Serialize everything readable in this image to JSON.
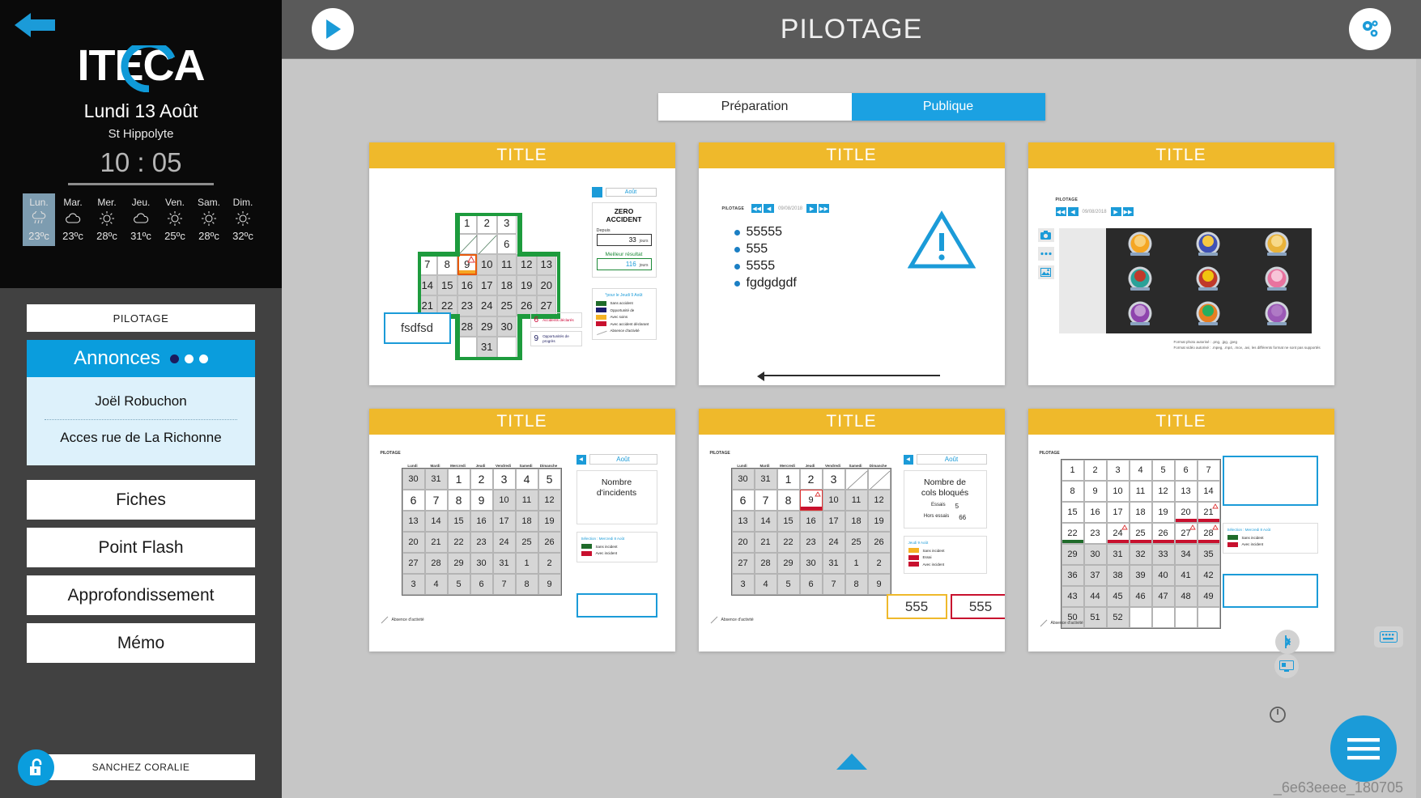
{
  "sidebar": {
    "back_icon": "back-arrow-icon",
    "logo": "ITECA",
    "date": "Lundi 13 Août",
    "place": "St Hippolyte",
    "clock": "10 : 05",
    "weather": [
      {
        "day": "Lun.",
        "temp": "23ºc",
        "icon": "rain-icon",
        "active": true
      },
      {
        "day": "Mar.",
        "temp": "23ºc",
        "icon": "cloud-icon",
        "active": false
      },
      {
        "day": "Mer.",
        "temp": "28ºc",
        "icon": "sun-icon",
        "active": false
      },
      {
        "day": "Jeu.",
        "temp": "31ºc",
        "icon": "cloud-icon",
        "active": false
      },
      {
        "day": "Ven.",
        "temp": "25ºc",
        "icon": "sun-icon",
        "active": false
      },
      {
        "day": "Sam.",
        "temp": "28ºc",
        "icon": "sun-icon",
        "active": false
      },
      {
        "day": "Dim.",
        "temp": "32ºc",
        "icon": "sun-icon",
        "active": false
      }
    ],
    "pilotage_label": "PILOTAGE",
    "annonces_label": "Annonces",
    "annonces_items": [
      "Joël Robuchon",
      "Acces rue de La Richonne"
    ],
    "menu": [
      "Fiches",
      "Point Flash",
      "Approfondissement",
      "Mémo"
    ],
    "user": "SANCHEZ CORALIE",
    "lock_icon": "unlock-icon"
  },
  "header": {
    "title": "PILOTAGE",
    "play_icon": "play-icon",
    "settings_icon": "gears-icon"
  },
  "tabs": [
    {
      "label": "Préparation",
      "active": false
    },
    {
      "label": "Publique",
      "active": true
    }
  ],
  "cards": [
    {
      "title": "TITLE"
    },
    {
      "title": "TITLE"
    },
    {
      "title": "TITLE"
    },
    {
      "title": "TITLE"
    },
    {
      "title": "TITLE"
    },
    {
      "title": "TITLE"
    }
  ],
  "card1": {
    "widget_label": "PILOTAGE",
    "cross_calendar": {
      "rows": [
        [
          {
            "v": "",
            "t": "blank"
          },
          {
            "v": "",
            "t": "blank"
          },
          {
            "v": "1",
            "t": "w"
          },
          {
            "v": "2",
            "t": "w"
          },
          {
            "v": "3",
            "t": "w"
          },
          {
            "v": "",
            "t": "blank"
          },
          {
            "v": "",
            "t": "blank"
          }
        ],
        [
          {
            "v": "",
            "t": "blank"
          },
          {
            "v": "",
            "t": "blank"
          },
          {
            "v": "",
            "t": "diag"
          },
          {
            "v": "",
            "t": "diag"
          },
          {
            "v": "6",
            "t": "w"
          },
          {
            "v": "",
            "t": "blank"
          },
          {
            "v": "",
            "t": "blank"
          }
        ],
        [
          {
            "v": "7",
            "t": "w"
          },
          {
            "v": "8",
            "t": "w"
          },
          {
            "v": "9",
            "t": "sel"
          },
          {
            "v": "10",
            "t": "g"
          },
          {
            "v": "11",
            "t": "g"
          },
          {
            "v": "12",
            "t": "g"
          },
          {
            "v": "13",
            "t": "g"
          }
        ],
        [
          {
            "v": "14",
            "t": "g"
          },
          {
            "v": "15",
            "t": "g"
          },
          {
            "v": "16",
            "t": "g"
          },
          {
            "v": "17",
            "t": "g"
          },
          {
            "v": "18",
            "t": "g"
          },
          {
            "v": "19",
            "t": "g"
          },
          {
            "v": "20",
            "t": "g"
          }
        ],
        [
          {
            "v": "21",
            "t": "g"
          },
          {
            "v": "22",
            "t": "g"
          },
          {
            "v": "23",
            "t": "g"
          },
          {
            "v": "24",
            "t": "g"
          },
          {
            "v": "25",
            "t": "g"
          },
          {
            "v": "26",
            "t": "g"
          },
          {
            "v": "27",
            "t": "g"
          }
        ],
        [
          {
            "v": "",
            "t": "blank"
          },
          {
            "v": "",
            "t": "blank"
          },
          {
            "v": "28",
            "t": "g"
          },
          {
            "v": "29",
            "t": "g"
          },
          {
            "v": "30",
            "t": "g"
          },
          {
            "v": "",
            "t": "blank"
          },
          {
            "v": "",
            "t": "blank"
          }
        ],
        [
          {
            "v": "",
            "t": "blank"
          },
          {
            "v": "",
            "t": "blank"
          },
          {
            "v": "",
            "t": "w"
          },
          {
            "v": "31",
            "t": "g"
          },
          {
            "v": "",
            "t": "w"
          },
          {
            "v": "",
            "t": "blank"
          },
          {
            "v": "",
            "t": "blank"
          }
        ]
      ]
    },
    "note_box_text": "fsdfsd",
    "month": "Août",
    "zero": {
      "title_line1": "ZERO",
      "title_line2": "ACCIDENT",
      "since_label": "Depuis",
      "since_value": "33",
      "since_unit": "jours",
      "best_label": "Meilleur résultat",
      "best_value": "116",
      "best_unit": "jours"
    },
    "legend_head": "*pour le Jeudi 9 Août",
    "legend": [
      {
        "label": "Sans accident",
        "color": "#1f6b2a"
      },
      {
        "label": "Opportunité de",
        "color": "#1b1b6e"
      },
      {
        "label": "Avec soins",
        "color": "#f5b324"
      },
      {
        "label": "Avec accident déclarant",
        "color": "#c8102e"
      },
      {
        "label": "Absence d'activité",
        "color": "#ffffff"
      }
    ],
    "counters": [
      {
        "value": "6",
        "label": "Accidents déclarés",
        "tone": "red"
      },
      {
        "value": "9",
        "label": "Opportunités de progrès",
        "tone": "navy"
      }
    ]
  },
  "card2": {
    "widget_label": "PILOTAGE",
    "date": "09/08/2018",
    "bullets": [
      "55555",
      "555",
      "5555",
      "fgdgdgdf"
    ],
    "warning_icon": "warning-triangle-icon"
  },
  "card3": {
    "widget_label": "PILOTAGE",
    "date": "09/08/2018",
    "tools": [
      "camera-icon",
      "ellipsis-icon",
      "image-icon"
    ],
    "badges": [
      {
        "name": "badge-beer",
        "color1": "#f5a623",
        "color2": "#f8d07a"
      },
      {
        "name": "badge-clock",
        "color1": "#3f51b5",
        "color2": "#f5c842"
      },
      {
        "name": "badge-ghost",
        "color1": "#e8b23a",
        "color2": "#f7d98a"
      },
      {
        "name": "badge-superhero",
        "color1": "#2aa198",
        "color2": "#c0392b"
      },
      {
        "name": "badge-moustache",
        "color1": "#c0392b",
        "color2": "#f1c40f"
      },
      {
        "name": "badge-chef",
        "color1": "#e8739f",
        "color2": "#f7c4d8"
      },
      {
        "name": "badge-ufo",
        "color1": "#8e44ad",
        "color2": "#c39bd3"
      },
      {
        "name": "badge-hulk",
        "color1": "#e67e22",
        "color2": "#27ae60"
      },
      {
        "name": "badge-alien",
        "color1": "#9b59b6",
        "color2": "#af7ac5"
      }
    ],
    "format_note_line1": "Format photo autorisé : .png, .jpg, .jpeg",
    "format_note_line2": "Format vidéo autorisé : .mpeg, .mp4, .mov, .avi, les différents format ne sont pas supportés"
  },
  "card4": {
    "widget_label": "PILOTAGE",
    "dow": [
      "Lundi",
      "Mardi",
      "Mercredi",
      "Jeudi",
      "Vendredi",
      "Samedi",
      "Dimanche"
    ],
    "rows": [
      [
        {
          "v": "30",
          "s": "g"
        },
        {
          "v": "31",
          "s": "g"
        },
        {
          "v": "1",
          "s": "b"
        },
        {
          "v": "2",
          "s": "b"
        },
        {
          "v": "3",
          "s": "b"
        },
        {
          "v": "4",
          "s": "b"
        },
        {
          "v": "5",
          "s": "b"
        }
      ],
      [
        {
          "v": "6",
          "s": "b"
        },
        {
          "v": "7",
          "s": "b"
        },
        {
          "v": "8",
          "s": "b"
        },
        {
          "v": "9",
          "s": "b"
        },
        {
          "v": "10",
          "s": "g"
        },
        {
          "v": "11",
          "s": "g"
        },
        {
          "v": "12",
          "s": "g"
        }
      ],
      [
        {
          "v": "13",
          "s": "g"
        },
        {
          "v": "14",
          "s": "g"
        },
        {
          "v": "15",
          "s": "g"
        },
        {
          "v": "16",
          "s": "g"
        },
        {
          "v": "17",
          "s": "g"
        },
        {
          "v": "18",
          "s": "g"
        },
        {
          "v": "19",
          "s": "g"
        }
      ],
      [
        {
          "v": "20",
          "s": "g"
        },
        {
          "v": "21",
          "s": "g"
        },
        {
          "v": "22",
          "s": "g"
        },
        {
          "v": "23",
          "s": "g"
        },
        {
          "v": "24",
          "s": "g"
        },
        {
          "v": "25",
          "s": "g"
        },
        {
          "v": "26",
          "s": "g"
        }
      ],
      [
        {
          "v": "27",
          "s": "g"
        },
        {
          "v": "28",
          "s": "g"
        },
        {
          "v": "29",
          "s": "g"
        },
        {
          "v": "30",
          "s": "g"
        },
        {
          "v": "31",
          "s": "g"
        },
        {
          "v": "1",
          "s": "g"
        },
        {
          "v": "2",
          "s": "g"
        }
      ],
      [
        {
          "v": "3",
          "s": "g"
        },
        {
          "v": "4",
          "s": "g"
        },
        {
          "v": "5",
          "s": "g"
        },
        {
          "v": "6",
          "s": "g"
        },
        {
          "v": "7",
          "s": "g"
        },
        {
          "v": "8",
          "s": "g"
        },
        {
          "v": "9",
          "s": "g"
        }
      ]
    ],
    "absence_label": "Absence d'activité",
    "month": "Août",
    "panel_title_l1": "Nombre",
    "panel_title_l2": "d'incidents",
    "legend_head": "Sélection : Mercredi 8 Août",
    "legend": [
      {
        "label": "Sans incident",
        "color": "#1f6b2a"
      },
      {
        "label": "Avec incident",
        "color": "#c8102e"
      }
    ]
  },
  "card5": {
    "widget_label": "PILOTAGE",
    "dow": [
      "Lundi",
      "Mardi",
      "Mercredi",
      "Jeudi",
      "Vendredi",
      "Samedi",
      "Dimanche"
    ],
    "rows": [
      [
        {
          "v": "30",
          "s": "g"
        },
        {
          "v": "31",
          "s": "g"
        },
        {
          "v": "1",
          "s": "b"
        },
        {
          "v": "2",
          "s": "b"
        },
        {
          "v": "3",
          "s": "b"
        },
        {
          "v": "",
          "s": "diag"
        },
        {
          "v": "",
          "s": "diag"
        }
      ],
      [
        {
          "v": "6",
          "s": "b"
        },
        {
          "v": "7",
          "s": "b"
        },
        {
          "v": "8",
          "s": "b"
        },
        {
          "v": "9",
          "s": "sel"
        },
        {
          "v": "10",
          "s": "g"
        },
        {
          "v": "11",
          "s": "g"
        },
        {
          "v": "12",
          "s": "g"
        }
      ],
      [
        {
          "v": "13",
          "s": "g"
        },
        {
          "v": "14",
          "s": "g"
        },
        {
          "v": "15",
          "s": "g"
        },
        {
          "v": "16",
          "s": "g"
        },
        {
          "v": "17",
          "s": "g"
        },
        {
          "v": "18",
          "s": "g"
        },
        {
          "v": "19",
          "s": "g"
        }
      ],
      [
        {
          "v": "20",
          "s": "g"
        },
        {
          "v": "21",
          "s": "g"
        },
        {
          "v": "22",
          "s": "g"
        },
        {
          "v": "23",
          "s": "g"
        },
        {
          "v": "24",
          "s": "g"
        },
        {
          "v": "25",
          "s": "g"
        },
        {
          "v": "26",
          "s": "g"
        }
      ],
      [
        {
          "v": "27",
          "s": "g"
        },
        {
          "v": "28",
          "s": "g"
        },
        {
          "v": "29",
          "s": "g"
        },
        {
          "v": "30",
          "s": "g"
        },
        {
          "v": "31",
          "s": "g"
        },
        {
          "v": "1",
          "s": "g"
        },
        {
          "v": "2",
          "s": "g"
        }
      ],
      [
        {
          "v": "3",
          "s": "g"
        },
        {
          "v": "4",
          "s": "g"
        },
        {
          "v": "5",
          "s": "g"
        },
        {
          "v": "6",
          "s": "g"
        },
        {
          "v": "7",
          "s": "g"
        },
        {
          "v": "8",
          "s": "g"
        },
        {
          "v": "9",
          "s": "g"
        }
      ]
    ],
    "absence_label": "Absence d'activité",
    "month": "Août",
    "panel_title_l1": "Nombre de",
    "panel_title_l2": "cols bloqués",
    "kv": [
      {
        "label": "Essais",
        "value": "5"
      },
      {
        "label": "Hors essais",
        "value": "66"
      }
    ],
    "legend_head": "Jeudi 9 Août",
    "legend": [
      {
        "label": "Sans incident",
        "color": "#f5b324"
      },
      {
        "label": "Essai",
        "color": "#c8102e"
      },
      {
        "label": "Avec incident",
        "color": "#c8102e"
      }
    ],
    "num_yellow": "555",
    "num_red": "555"
  },
  "card6": {
    "widget_label": "PILOTAGE",
    "rows": [
      [
        {
          "v": "1"
        },
        {
          "v": "2"
        },
        {
          "v": "3"
        },
        {
          "v": "4"
        },
        {
          "v": "5"
        },
        {
          "v": "6"
        },
        {
          "v": "7"
        }
      ],
      [
        {
          "v": "8"
        },
        {
          "v": "9"
        },
        {
          "v": "10"
        },
        {
          "v": "11"
        },
        {
          "v": "12"
        },
        {
          "v": "13"
        },
        {
          "v": "14"
        }
      ],
      [
        {
          "v": "15"
        },
        {
          "v": "16"
        },
        {
          "v": "17"
        },
        {
          "v": "18"
        },
        {
          "v": "19"
        },
        {
          "v": "20",
          "bar": "red"
        },
        {
          "v": "21",
          "bar": "red",
          "warn": true
        }
      ],
      [
        {
          "v": "22",
          "bar": "green"
        },
        {
          "v": "23"
        },
        {
          "v": "24",
          "bar": "red",
          "warn": true
        },
        {
          "v": "25",
          "bar": "red"
        },
        {
          "v": "26",
          "bar": "red"
        },
        {
          "v": "27",
          "bar": "red",
          "warn": true
        },
        {
          "v": "28",
          "bar": "red",
          "warn": true
        }
      ],
      [
        {
          "v": "29",
          "s": "g"
        },
        {
          "v": "30",
          "s": "g"
        },
        {
          "v": "31",
          "s": "g"
        },
        {
          "v": "32",
          "s": "g"
        },
        {
          "v": "33",
          "s": "g"
        },
        {
          "v": "34",
          "s": "g"
        },
        {
          "v": "35",
          "s": "g"
        }
      ],
      [
        {
          "v": "36",
          "s": "g"
        },
        {
          "v": "37",
          "s": "g"
        },
        {
          "v": "38",
          "s": "g"
        },
        {
          "v": "39",
          "s": "g"
        },
        {
          "v": "40",
          "s": "g"
        },
        {
          "v": "41",
          "s": "g"
        },
        {
          "v": "42",
          "s": "g"
        }
      ],
      [
        {
          "v": "43",
          "s": "g"
        },
        {
          "v": "44",
          "s": "g"
        },
        {
          "v": "45",
          "s": "g"
        },
        {
          "v": "46",
          "s": "g"
        },
        {
          "v": "47",
          "s": "g"
        },
        {
          "v": "48",
          "s": "g"
        },
        {
          "v": "49",
          "s": "g"
        }
      ],
      [
        {
          "v": "50",
          "s": "g"
        },
        {
          "v": "51",
          "s": "g"
        },
        {
          "v": "52",
          "s": "g"
        },
        {
          "v": ""
        },
        {
          "v": ""
        },
        {
          "v": ""
        },
        {
          "v": ""
        }
      ]
    ],
    "absence_label": "Absence d'activité",
    "legend_head": "Sélection : Mercredi 8 Août",
    "legend": [
      {
        "label": "Sans incident",
        "color": "#1f6b2a"
      },
      {
        "label": "Avec incident",
        "color": "#c8102e"
      }
    ]
  },
  "footer": {
    "id": "_6e63eeee_180705",
    "menu_icon": "hamburger-icon",
    "power_icon": "power-icon",
    "bluetooth_icon": "bluetooth-icon",
    "keyboard_icon": "keyboard-icon",
    "screen_icon": "screen-icon",
    "collapse_icon": "chevron-up-icon"
  },
  "colors": {
    "accent": "#1b9bd8",
    "card_header": "#efb92b",
    "sidebar": "#414141",
    "main_bg": "#c6c6c6"
  }
}
